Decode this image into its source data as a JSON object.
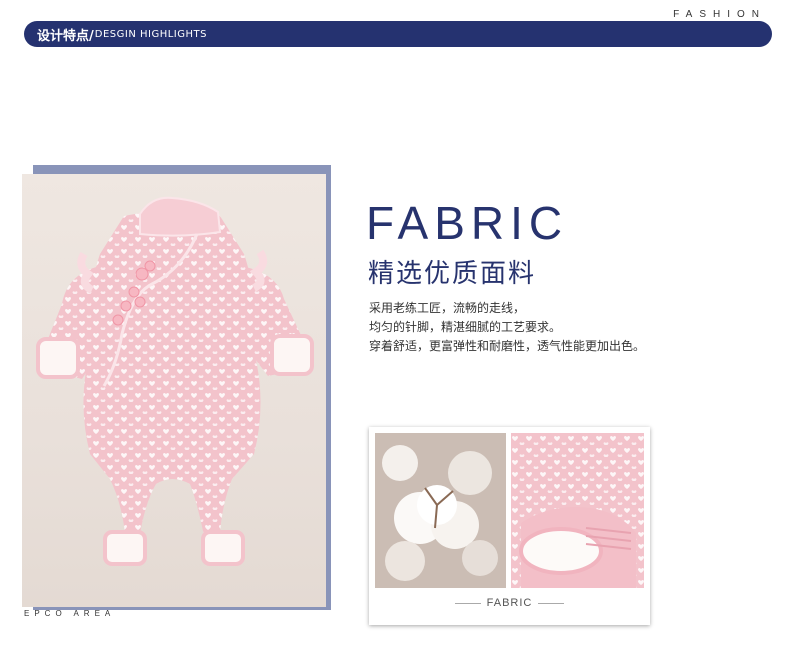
{
  "header": {
    "fashion_tag": "FASHION",
    "banner_cn": "设计特点/",
    "banner_en": "DESGIN HIGHLIGHTS"
  },
  "photo": {
    "footer_tag": "EPCO AREA"
  },
  "fabric": {
    "title": "FABRIC",
    "subtitle": "精选优质面料",
    "description": [
      "采用老练工匠，流畅的走线，",
      "均匀的针脚，精湛细腻的工艺要求。",
      "穿着舒适，更富弹性和耐磨性，透气性能更加出色。"
    ],
    "card_caption": "FABRIC"
  },
  "colors": {
    "brand_navy": "#253270",
    "shadow_block": "#8994b9",
    "romper_pink": "#f3c3cb"
  }
}
